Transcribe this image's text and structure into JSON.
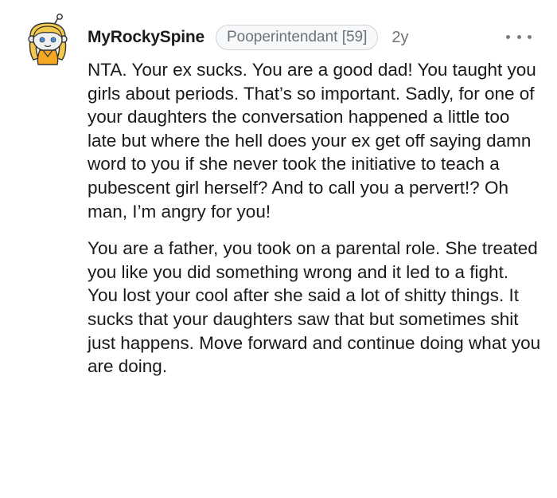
{
  "comment": {
    "username": "MyRockySpine",
    "flair": "Pooperintendant [59]",
    "timestamp": "2y",
    "more_icon": "ellipsis-icon",
    "avatar_icon": "snoo-avatar-icon",
    "paragraphs": [
      "NTA. Your ex sucks. You are a good dad! You taught you girls about periods. That’s so important. Sadly, for one of your daughters the conversation happened a little too late but where the hell does your ex get off saying damn word to you if she never took the initiative to teach a pubescent girl herself? And to call you a pervert!? Oh man, I’m angry for you!",
      "You are a father, you took on a parental role. She treated you like you did something wrong and it led to a fight. You lost your cool after she said a lot of shitty things. It sucks that your daughters saw that but sometimes shit just happens. Move forward and continue doing what you are doing."
    ]
  },
  "colors": {
    "text": "#1a1a1b",
    "meta": "#6f7275",
    "avatar_hair": "#f2c94c",
    "avatar_skin": "#eef0f2"
  }
}
